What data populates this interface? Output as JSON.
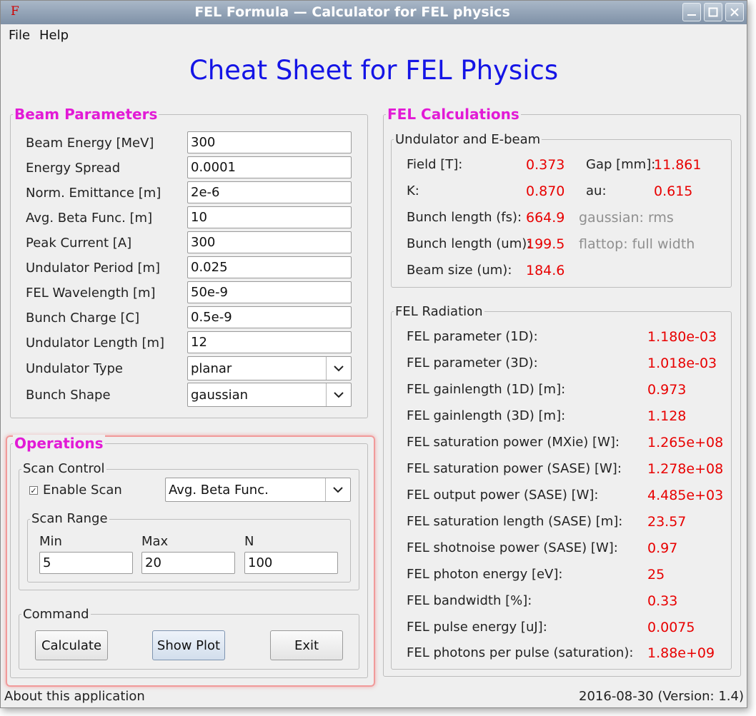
{
  "window": {
    "title": "FEL Formula — Calculator for FEL physics",
    "app_icon": "F"
  },
  "menu": {
    "file": "File",
    "help": "Help"
  },
  "headline": "Cheat Sheet for FEL Physics",
  "beam_parameters": {
    "title": "Beam Parameters",
    "fields": [
      {
        "label": "Beam Energy [MeV]",
        "value": "300"
      },
      {
        "label": "Energy Spread",
        "value": "0.0001"
      },
      {
        "label": "Norm. Emittance [m]",
        "value": "2e-6"
      },
      {
        "label": "Avg. Beta Func. [m]",
        "value": "10"
      },
      {
        "label": "Peak Current [A]",
        "value": "300"
      },
      {
        "label": "Undulator Period [m]",
        "value": "0.025"
      },
      {
        "label": "FEL Wavelength [m]",
        "value": "50e-9"
      },
      {
        "label": "Bunch Charge [C]",
        "value": "0.5e-9"
      },
      {
        "label": "Undulator Length [m]",
        "value": "12"
      }
    ],
    "undulator_type": {
      "label": "Undulator Type",
      "value": "planar"
    },
    "bunch_shape": {
      "label": "Bunch Shape",
      "value": "gaussian"
    }
  },
  "operations": {
    "title": "Operations",
    "scan_control": {
      "title": "Scan Control",
      "enable_label": "Enable Scan",
      "enabled": true,
      "parameter": "Avg. Beta Func."
    },
    "scan_range": {
      "title": "Scan Range",
      "min_label": "Min",
      "min": "5",
      "max_label": "Max",
      "max": "20",
      "n_label": "N",
      "n": "100"
    },
    "command": {
      "title": "Command",
      "calculate": "Calculate",
      "show_plot": "Show Plot",
      "exit": "Exit"
    }
  },
  "fel_calculations": {
    "title": "FEL Calculations",
    "undulator_ebeam": {
      "title": "Undulator and E-beam",
      "field_label": "Field [T]:",
      "field": "0.373",
      "gap_label": "Gap [mm]:",
      "gap": "11.861",
      "k_label": "K:",
      "k": "0.870",
      "au_label": "au:",
      "au": "0.615",
      "bunch_fs_label": "Bunch length (fs):",
      "bunch_fs": "664.9",
      "bunch_fs_note": "gaussian: rms",
      "bunch_um_label": "Bunch length (um):",
      "bunch_um": "199.5",
      "bunch_um_note": "flattop: full width",
      "beam_size_label": "Beam size (um):",
      "beam_size": "184.6"
    },
    "fel_radiation": {
      "title": "FEL Radiation",
      "rows": [
        {
          "label": "FEL parameter (1D):",
          "value": "1.180e-03"
        },
        {
          "label": "FEL parameter (3D):",
          "value": "1.018e-03"
        },
        {
          "label": "FEL gainlength (1D) [m]:",
          "value": "0.973"
        },
        {
          "label": "FEL gainlength (3D) [m]:",
          "value": "1.128"
        },
        {
          "label": "FEL saturation power (MXie) [W]:",
          "value": "1.265e+08"
        },
        {
          "label": "FEL saturation power (SASE) [W]:",
          "value": "1.278e+08"
        },
        {
          "label": "FEL output power (SASE) [W]:",
          "value": "4.485e+03"
        },
        {
          "label": "FEL saturation length (SASE) [m]:",
          "value": "23.57"
        },
        {
          "label": "FEL shotnoise power (SASE) [W]:",
          "value": "0.97"
        },
        {
          "label": "FEL photon energy [eV]:",
          "value": "25"
        },
        {
          "label": "FEL bandwidth [%]:",
          "value": "0.33"
        },
        {
          "label": "FEL pulse energy [uJ]:",
          "value": "0.0075"
        },
        {
          "label": "FEL photons per pulse (saturation):",
          "value": "1.88e+09"
        }
      ]
    }
  },
  "status": {
    "about": "About this application",
    "version": "2016-08-30  (Version: 1.4)"
  },
  "colors": {
    "headline": "#1414e6",
    "group_title": "#e21ad6",
    "result_value": "#e80000",
    "note": "#8f8f8f"
  }
}
